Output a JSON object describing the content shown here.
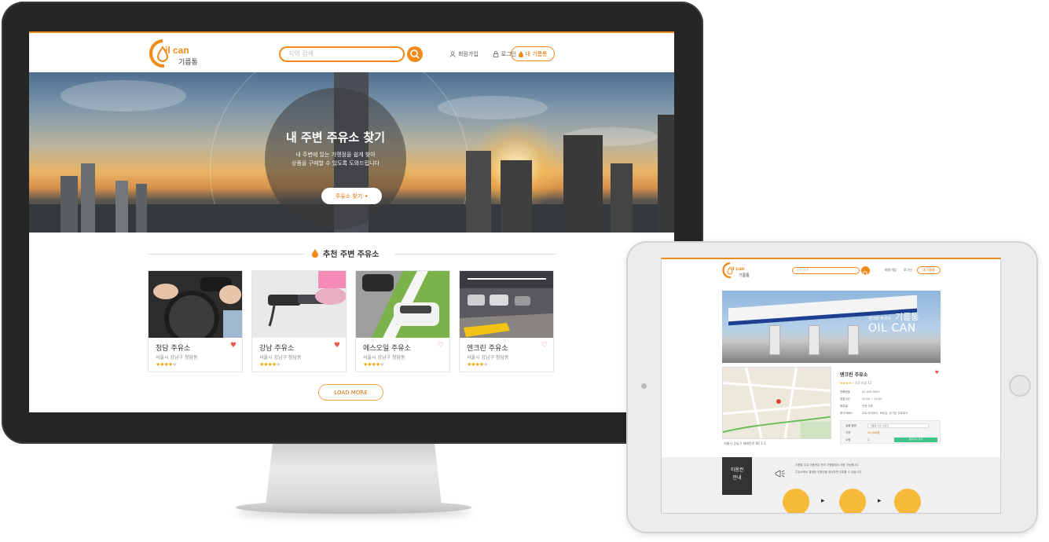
{
  "desktop": {
    "logo": {
      "text": "il can",
      "sub": "기름통"
    },
    "search": {
      "placeholder": "지역 검색"
    },
    "header": {
      "signup": "회원가입",
      "login": "로그인",
      "my_button": "내 기름통"
    },
    "hero": {
      "title": "내 주변 주유소 찾기",
      "subtitle_line1": "내 주변에 있는 가맹점을 쉽게 찾아",
      "subtitle_line2": "상품을 구매할 수 있도록 도와드립니다",
      "button": "주유소 찾기"
    },
    "recommended": {
      "title": "추천 주변 주유소",
      "cards": [
        {
          "name": "청담 주유소",
          "address": "서울시 강남구 청담동",
          "rating": 4,
          "favorite": true
        },
        {
          "name": "강남 주유소",
          "address": "서울시 강남구 청담동",
          "rating": 4,
          "favorite": true
        },
        {
          "name": "에스오일 주유소",
          "address": "서울시 강남구 청담동",
          "rating": 4,
          "favorite": false
        },
        {
          "name": "엔크린 주유소",
          "address": "서울시 강남구 청담동",
          "rating": 4,
          "favorite": false
        }
      ],
      "load_more": "LOAD MORE"
    }
  },
  "tablet": {
    "search": {
      "placeholder": "지역 검색"
    },
    "header": {
      "signup": "회원가입",
      "login": "로그인",
      "my_button": "내 기름통"
    },
    "photo": {
      "sub": "엔크린 주유소",
      "title_ko": "기름통",
      "title_en": "OIL CAN"
    },
    "detail": {
      "title": "엔크린 주유소",
      "rating_text": "4.0",
      "reviews": "리뷰 12",
      "rows": [
        {
          "label": "전화번호",
          "value": "02-000-0000"
        },
        {
          "label": "영업시간",
          "value": "00:00 ~ 24:00"
        },
        {
          "label": "휴무일",
          "value": "연중 무휴"
        },
        {
          "label": "부가서비스",
          "value": "무료 와이파이, 화장실, 공기압 무료체크"
        }
      ],
      "order": {
        "product_label": "상품 종류",
        "product_value": "기름통 주유 이용권",
        "price_label": "가격",
        "price_value": "35,000원",
        "qty_label": "수량",
        "qty_value": "1",
        "buy_button": "장바구니 담기"
      },
      "address": "서울시 강남구 테헤란로 00 1-1"
    },
    "usage": {
      "title_line1": "이용권",
      "title_line2": "안내",
      "text_line1": "기름통 주유 이용권은 전국 가맹점에서 사용 가능합니다",
      "text_line2": "주유소에서 결제한 이용권을 제시하면 주유할 수 있습니다"
    }
  },
  "colors": {
    "accent": "#f28a1a",
    "heart": "#e8584a",
    "buy": "#41c28b"
  }
}
